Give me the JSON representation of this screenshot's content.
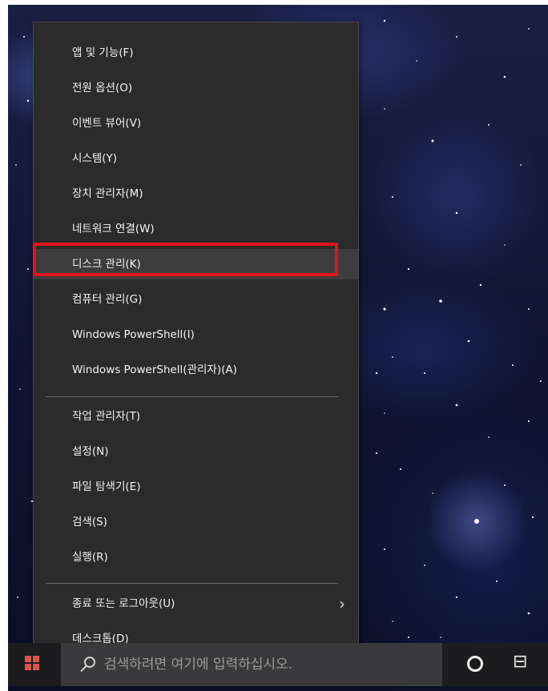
{
  "context_menu": {
    "items": [
      {
        "label": "앱 및 기능(F)"
      },
      {
        "label": "전원 옵션(O)"
      },
      {
        "label": "이벤트 뷰어(V)"
      },
      {
        "label": "시스템(Y)"
      },
      {
        "label": "장치 관리자(M)"
      },
      {
        "label": "네트워크 연결(W)"
      },
      {
        "label": "디스크 관리(K)",
        "highlighted": true
      },
      {
        "label": "컴퓨터 관리(G)"
      },
      {
        "label": "Windows PowerShell(I)"
      },
      {
        "label": "Windows PowerShell(관리자)(A)"
      },
      {
        "label": "작업 관리자(T)"
      },
      {
        "label": "설정(N)"
      },
      {
        "label": "파일 탐색기(E)"
      },
      {
        "label": "검색(S)"
      },
      {
        "label": "실행(R)"
      },
      {
        "label": "종료 또는 로그아웃(U)",
        "submenu": true
      },
      {
        "label": "데스크톱(D)"
      }
    ],
    "highlight_color": "#e3121d",
    "submenu_chevron": "›"
  },
  "taskbar": {
    "search_placeholder": "검색하려면 여기에 입력하십시오.",
    "start_icon": "windows-logo-icon",
    "search_icon": "search-icon",
    "cortana_icon": "cortana-circle-icon",
    "taskview_icon": "task-view-icon",
    "taskview_glyph": "⊟"
  }
}
